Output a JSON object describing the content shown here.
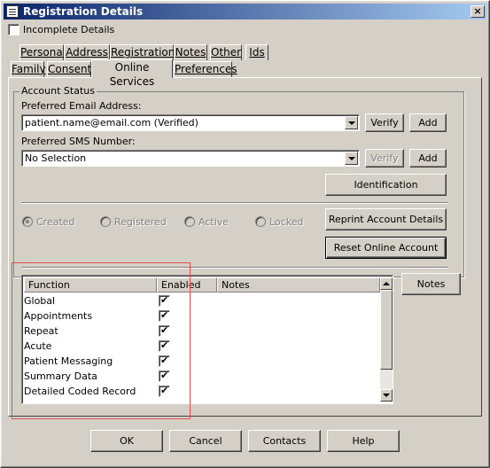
{
  "window": {
    "title": "Registration Details",
    "close_label": "×"
  },
  "incomplete": {
    "label": "Incomplete Details",
    "checked": false
  },
  "tabs_row1": [
    "Personal",
    "Address",
    "Registration",
    "Notes",
    "Other",
    "Ids"
  ],
  "tabs_row2": [
    "Family",
    "Consent",
    "Online Services",
    "Preferences"
  ],
  "active_tab": "Online Services",
  "account_status": {
    "group_label": "Account Status",
    "email_label": "Preferred Email Address:",
    "email_value": "patient.name@email.com (Verified)",
    "sms_label": "Preferred SMS Number:",
    "sms_value": "No Selection",
    "verify_label": "Verify",
    "add_label": "Add",
    "identification_label": "Identification",
    "reprint_label": "Reprint Account Details",
    "reset_label": "Reset Online Account",
    "statuses": [
      "Created",
      "Registered",
      "Active",
      "Locked"
    ],
    "selected_status": "Created"
  },
  "functions": {
    "columns": [
      "Function",
      "Enabled",
      "Notes"
    ],
    "rows": [
      {
        "function": "Global",
        "enabled": true
      },
      {
        "function": "Appointments",
        "enabled": true
      },
      {
        "function": "Repeat",
        "enabled": true
      },
      {
        "function": "Acute",
        "enabled": true
      },
      {
        "function": "Patient Messaging",
        "enabled": true
      },
      {
        "function": "Summary Data",
        "enabled": true
      },
      {
        "function": "Detailed Coded Record",
        "enabled": true
      }
    ],
    "notes_button": "Notes"
  },
  "footer": {
    "ok": "OK",
    "cancel": "Cancel",
    "contacts": "Contacts",
    "help": "Help"
  },
  "colors": {
    "title_start": "#0a246a",
    "title_end": "#a6caf0",
    "highlight": "#e05050",
    "face": "#d4d0c8"
  }
}
